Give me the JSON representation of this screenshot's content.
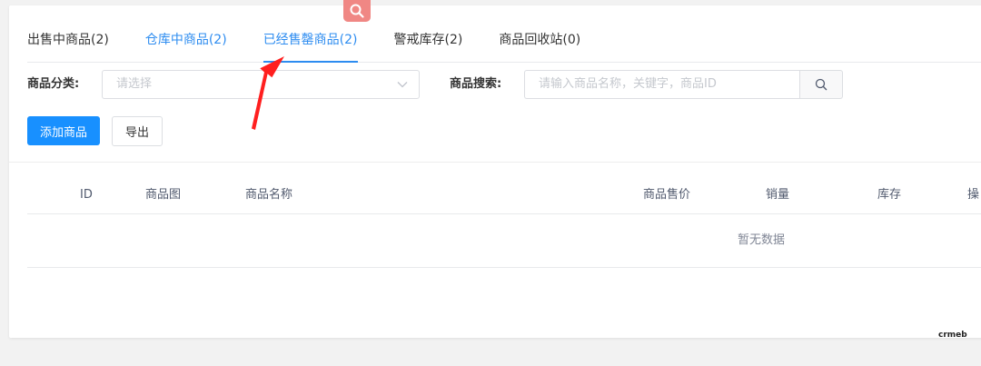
{
  "tabs": [
    {
      "label": "出售中商品(2)"
    },
    {
      "label": "仓库中商品(2)"
    },
    {
      "label": "已经售罄商品(2)"
    },
    {
      "label": "警戒库存(2)"
    },
    {
      "label": "商品回收站(0)"
    }
  ],
  "active_tab_index": 2,
  "filters": {
    "category_label": "商品分类:",
    "category_placeholder": "请选择",
    "search_label": "商品搜索:",
    "search_placeholder": "请输入商品名称，关键字，商品ID"
  },
  "actions": {
    "add_label": "添加商品",
    "export_label": "导出"
  },
  "table": {
    "columns": [
      "ID",
      "商品图",
      "商品名称",
      "商品售价",
      "销量",
      "库存",
      "操"
    ],
    "empty_text": "暂无数据"
  },
  "watermark": "crmeb",
  "colors": {
    "accent": "#2d8cf0",
    "primary_button": "#1890ff",
    "annotation_arrow": "#ff1f1f",
    "search_badge": "#f08784"
  },
  "icons": {
    "badge": "search-icon",
    "select": "chevron-down-icon",
    "search_button": "search-icon"
  }
}
